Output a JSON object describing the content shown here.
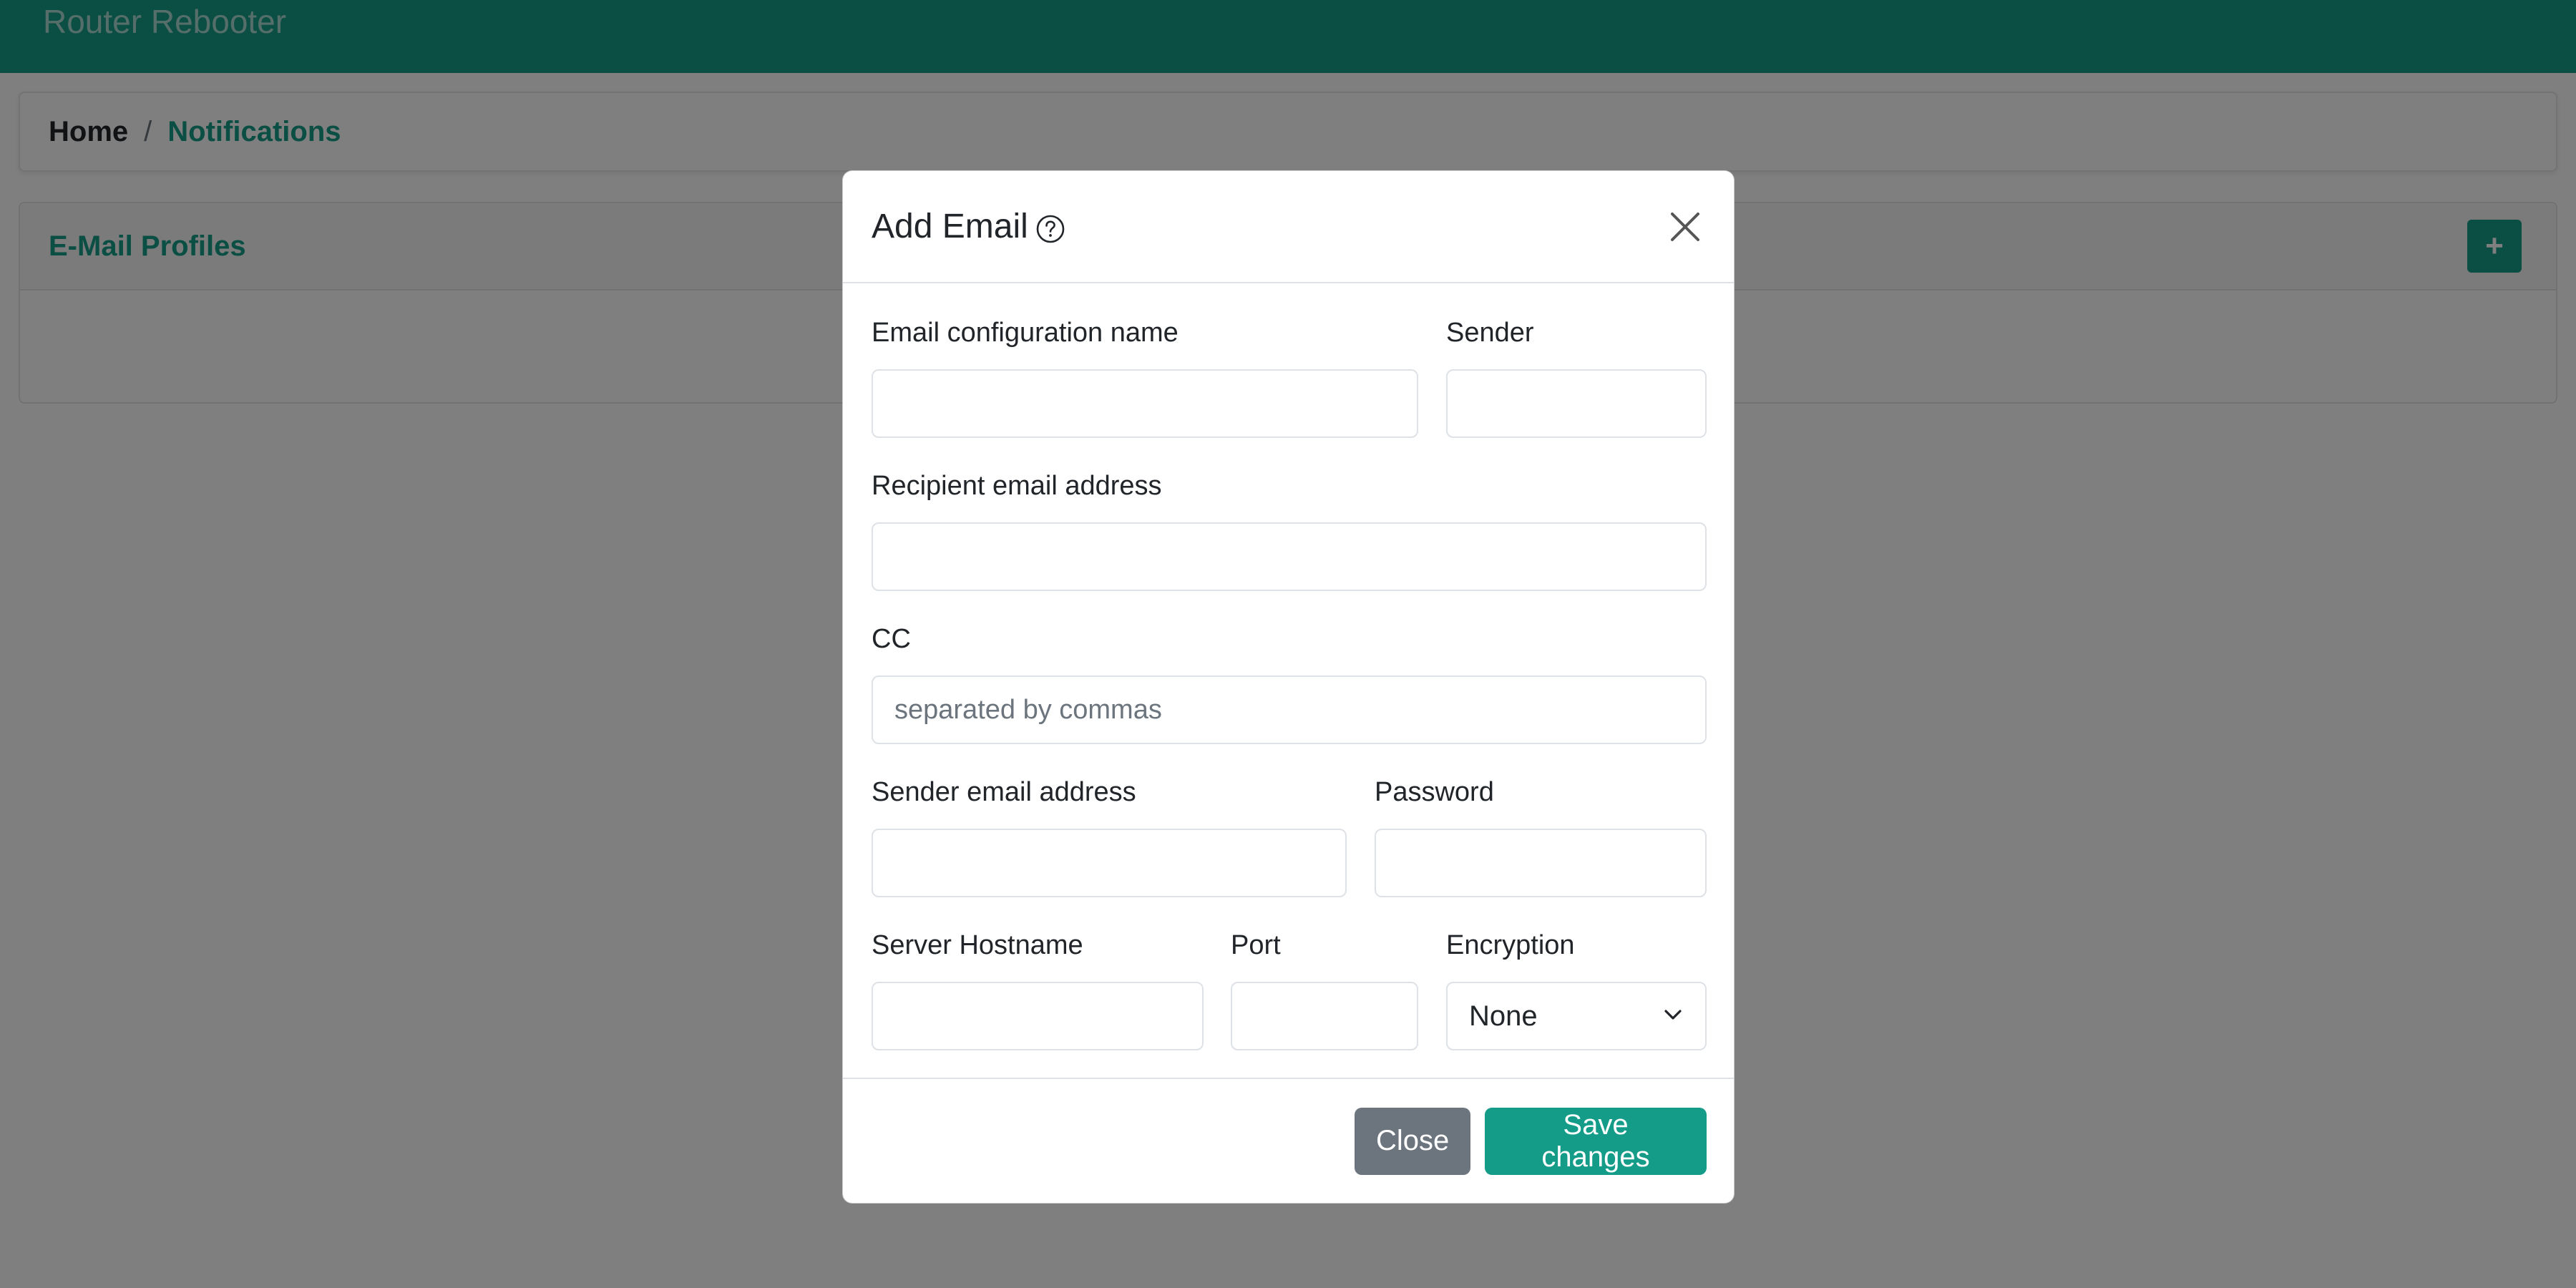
{
  "navbar": {
    "brand": "Router Rebooter"
  },
  "breadcrumb": {
    "home": "Home",
    "separator": "/",
    "current": "Notifications"
  },
  "profiles": {
    "title": "E-Mail Profiles",
    "add_label": "+"
  },
  "modal": {
    "title": "Add Email",
    "fields": {
      "config_name": {
        "label": "Email configuration name",
        "value": "",
        "placeholder": ""
      },
      "sender": {
        "label": "Sender",
        "value": "",
        "placeholder": ""
      },
      "recipient": {
        "label": "Recipient email address",
        "value": "",
        "placeholder": ""
      },
      "cc": {
        "label": "CC",
        "value": "",
        "placeholder": "separated by commas"
      },
      "sender_email": {
        "label": "Sender email address",
        "value": "",
        "placeholder": ""
      },
      "password": {
        "label": "Password",
        "value": "",
        "placeholder": ""
      },
      "server_hostname": {
        "label": "Server Hostname",
        "value": "",
        "placeholder": ""
      },
      "port": {
        "label": "Port",
        "value": "",
        "placeholder": ""
      },
      "encryption": {
        "label": "Encryption",
        "selected": "None"
      }
    },
    "footer": {
      "close_label": "Close",
      "save_label": "Save changes"
    }
  },
  "colors": {
    "accent": "#149c88",
    "secondary": "#6c757d",
    "backdrop": "rgba(0,0,0,0.5)"
  },
  "icons": {
    "help": "question-circle-icon",
    "close": "close-icon",
    "select": "chevron-down-icon",
    "add": "plus-icon"
  }
}
